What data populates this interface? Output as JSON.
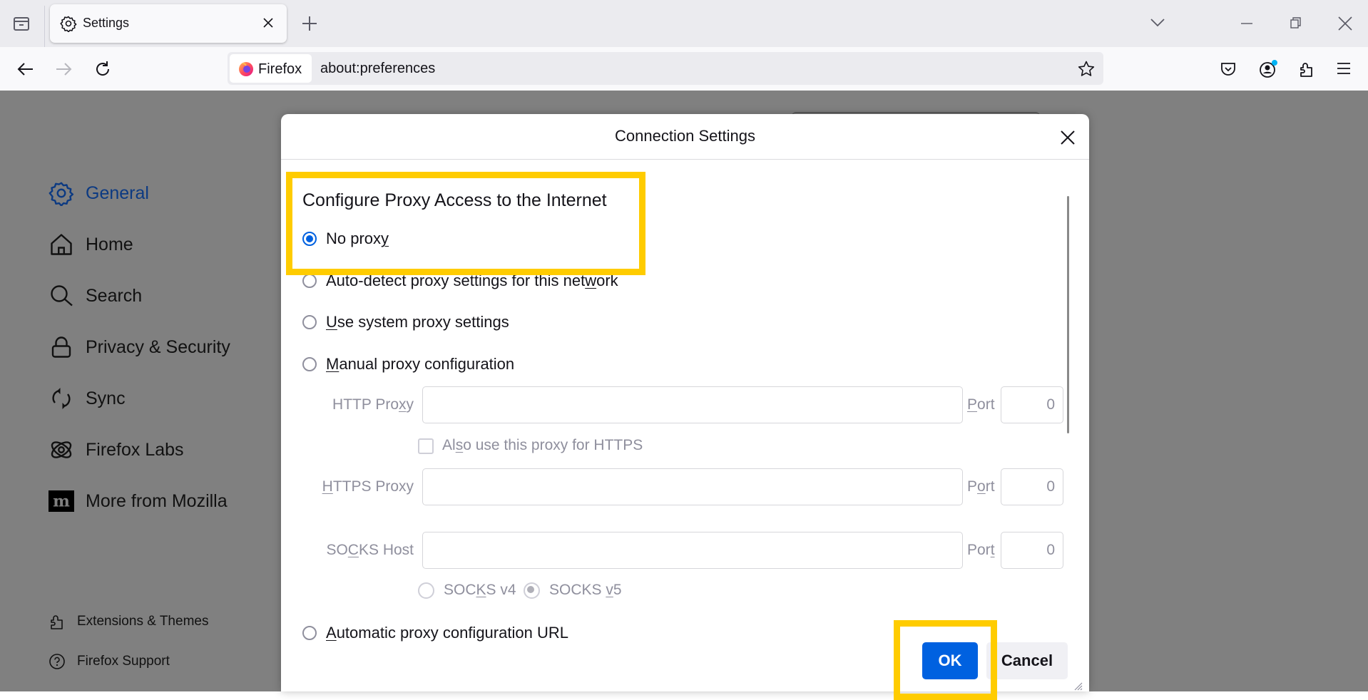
{
  "browser": {
    "tab": {
      "title": "Settings",
      "icon": "gear-icon"
    },
    "new_tab_label": "+",
    "identity_label": "Firefox",
    "url": "about:preferences",
    "colors": {
      "accent": "#0061e0",
      "highlight": "#ffcc00",
      "sidebar_active": "#0c3a82"
    }
  },
  "sidebar": {
    "items": [
      {
        "label": "General",
        "icon": "gear-icon",
        "active": true
      },
      {
        "label": "Home",
        "icon": "home-icon"
      },
      {
        "label": "Search",
        "icon": "search-icon"
      },
      {
        "label": "Privacy & Security",
        "icon": "lock-icon"
      },
      {
        "label": "Sync",
        "icon": "sync-icon"
      },
      {
        "label": "Firefox Labs",
        "icon": "atom-icon"
      },
      {
        "label": "More from Mozilla",
        "icon": "mozilla-logo-icon"
      }
    ],
    "footer": [
      {
        "label": "Extensions & Themes",
        "icon": "puzzle-icon"
      },
      {
        "label": "Firefox Support",
        "icon": "help-icon"
      }
    ]
  },
  "dialog": {
    "title": "Connection Settings",
    "section_title": "Configure Proxy Access to the Internet",
    "options": {
      "no_proxy": {
        "pre": "No prox",
        "key": "y",
        "post": "",
        "selected": true
      },
      "auto_detect": {
        "pre": "Auto-detect proxy settings for this net",
        "key": "w",
        "post": "ork",
        "selected": false
      },
      "system": {
        "pre": "",
        "key": "U",
        "post": "se system proxy settings",
        "selected": false
      },
      "manual": {
        "pre": "",
        "key": "M",
        "post": "anual proxy configuration",
        "selected": false
      },
      "auto_url": {
        "pre": "",
        "key": "A",
        "post": "utomatic proxy configuration URL",
        "selected": false
      }
    },
    "http_proxy": {
      "label_pre": "HTTP Pro",
      "label_key": "x",
      "label_post": "y",
      "value": "",
      "port_pre": "",
      "port_key": "P",
      "port_post": "ort",
      "port": "0"
    },
    "also_https": {
      "pre": "Al",
      "key": "s",
      "post": "o use this proxy for HTTPS",
      "checked": false
    },
    "https_proxy": {
      "label_pre": "",
      "label_key": "H",
      "label_post": "TTPS Proxy",
      "value": "",
      "port_pre": "P",
      "port_key": "o",
      "port_post": "rt",
      "port": "0"
    },
    "socks_host": {
      "label_pre": "SO",
      "label_key": "C",
      "label_post": "KS Host",
      "value": "",
      "port_pre": "Por",
      "port_key": "t",
      "port_post": "",
      "port": "0"
    },
    "socks_v4": {
      "pre": "SOC",
      "key": "K",
      "post": "S v4",
      "selected": false
    },
    "socks_v5": {
      "pre": "SOCKS ",
      "key": "v",
      "post": "5",
      "selected": true
    },
    "ok_label": "OK",
    "cancel_label": "Cancel"
  }
}
